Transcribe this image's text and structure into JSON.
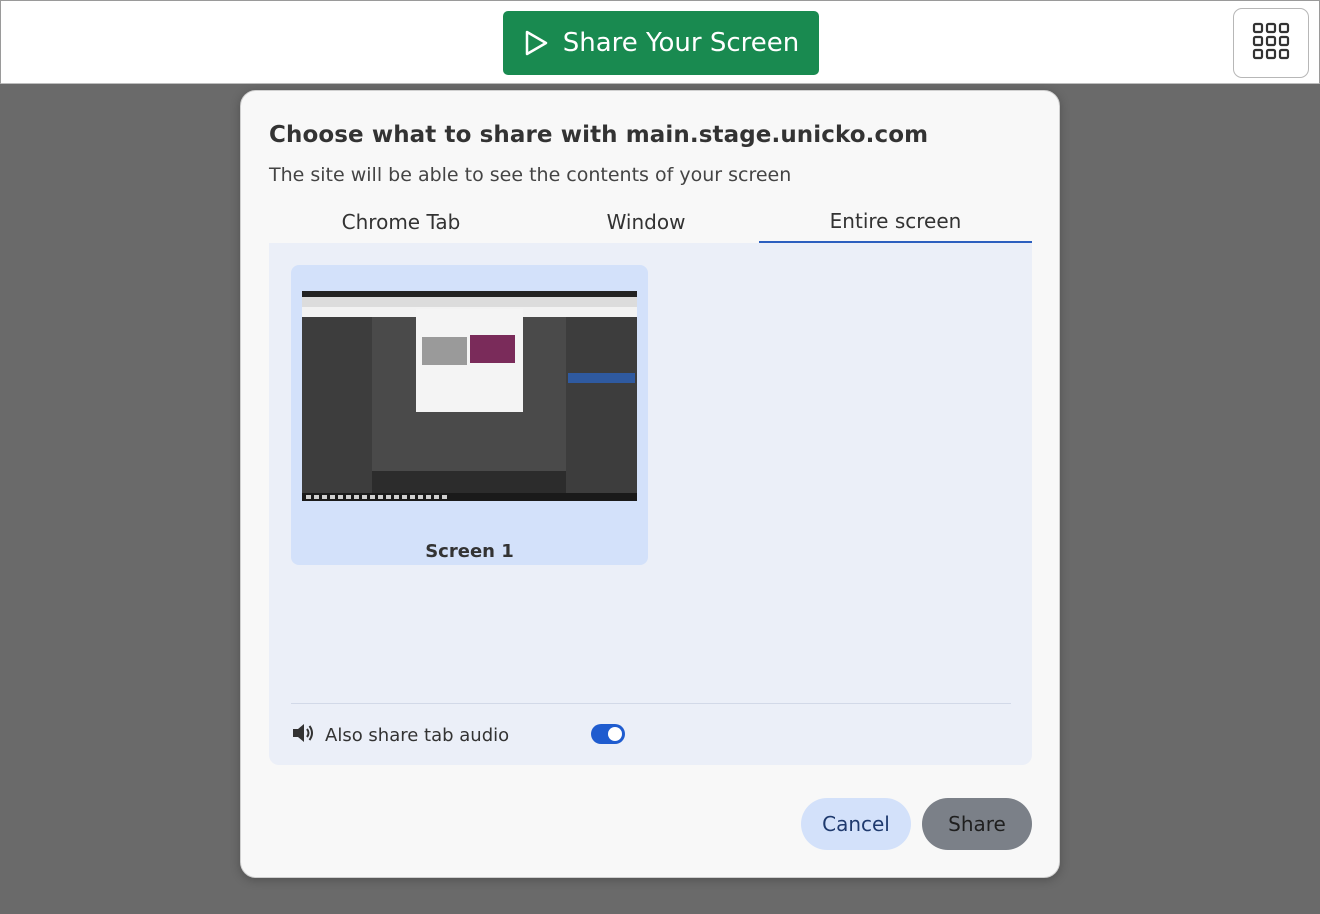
{
  "topbar": {
    "share_button_label": "Share Your Screen",
    "share_button_color": "#198a50",
    "share_icon": "play-outline-icon",
    "menu_icon": "grid-9-icon"
  },
  "dialog": {
    "title": "Choose what to share with main.stage.unicko.com",
    "subtitle": "The site will be able to see the contents of your screen",
    "tabs": [
      {
        "label": "Chrome Tab",
        "active": false
      },
      {
        "label": "Window",
        "active": false
      },
      {
        "label": "Entire screen",
        "active": true
      }
    ],
    "screens": [
      {
        "label": "Screen 1",
        "selected": true
      }
    ],
    "audio": {
      "icon": "speaker-icon",
      "label": "Also share tab audio",
      "enabled": true
    },
    "buttons": {
      "cancel": "Cancel",
      "share": "Share"
    },
    "accent_color": "#1f5ccf"
  }
}
